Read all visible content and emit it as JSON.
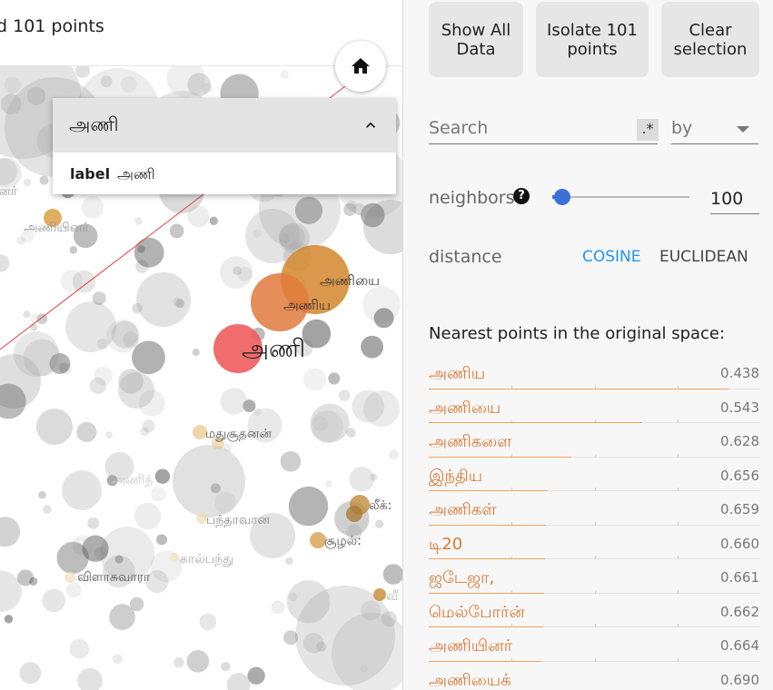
{
  "status": {
    "text": "d 101 points"
  },
  "popup": {
    "title": "அணி",
    "field_label": "label",
    "field_value": "அணி"
  },
  "buttons": {
    "show_all": "Show All\nData",
    "isolate": "Isolate 101\npoints",
    "clear": "Clear\nselection"
  },
  "search": {
    "placeholder": "Search",
    "regex": ".*",
    "by_placeholder": "by"
  },
  "neighbors": {
    "label": "neighbors",
    "value": "100",
    "slider_fraction": 0.05
  },
  "distance": {
    "label": "distance",
    "cosine": "COSINE",
    "euclidean": "EUCLIDEAN",
    "selected": "COSINE",
    "selected_color": "#2196f3"
  },
  "nearest": {
    "title": "Nearest points in the original space:",
    "items": [
      {
        "word": "அணிய",
        "value": "0.438"
      },
      {
        "word": "அணியை",
        "value": "0.543"
      },
      {
        "word": "அணிகளை",
        "value": "0.628"
      },
      {
        "word": "இந்திய",
        "value": "0.656"
      },
      {
        "word": "அணிகள்",
        "value": "0.659"
      },
      {
        "word": "டி20",
        "value": "0.660"
      },
      {
        "word": "ஜடேஜா,",
        "value": "0.661"
      },
      {
        "word": "மெல்போர்ன்",
        "value": "0.662"
      },
      {
        "word": "அணியினர்",
        "value": "0.664"
      },
      {
        "word": "அணியைக்",
        "value": "0.690"
      }
    ]
  },
  "scatter": {
    "selected_label": "அணி",
    "labels": [
      "அணியை",
      "அணிய",
      "மதுசூதனன்",
      "பந்தாவான",
      "சூழல்:",
      "கால்பந்து",
      "விளாசுவாரா",
      "அணியினர்",
      "னர்",
      "லீக்:",
      "வீ",
      "அணிந்"
    ],
    "colors": {
      "selected": "#f05c5c",
      "near1": "#e3803f",
      "near2": "#d99030",
      "faded": "#e6c68a",
      "gray": "#bdbdbd"
    }
  }
}
